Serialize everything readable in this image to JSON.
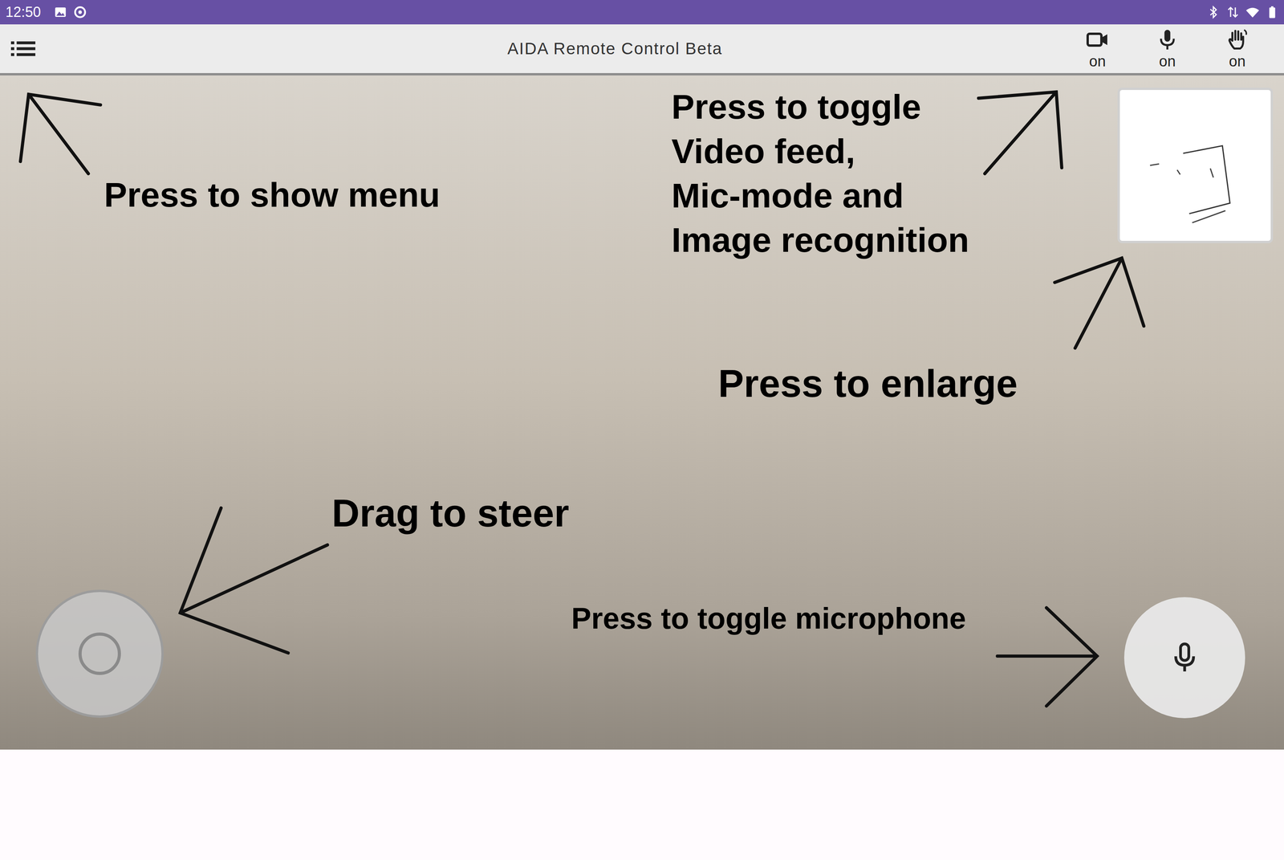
{
  "status_bar": {
    "time": "12:50"
  },
  "app_bar": {
    "title": "AIDA Remote Control Beta",
    "toggles": [
      {
        "kind": "video",
        "label": "on",
        "on": true
      },
      {
        "kind": "mic",
        "label": "on",
        "on": true
      },
      {
        "kind": "gesture",
        "label": "on",
        "on": true
      }
    ]
  },
  "annotations": {
    "menu": "Press to show menu",
    "toggles": [
      "Press to toggle",
      "Video feed,",
      "Mic-mode and",
      "Image recognition"
    ],
    "enlarge": "Press to enlarge",
    "steer": "Drag to steer",
    "microphone": "Press to toggle microphone"
  }
}
